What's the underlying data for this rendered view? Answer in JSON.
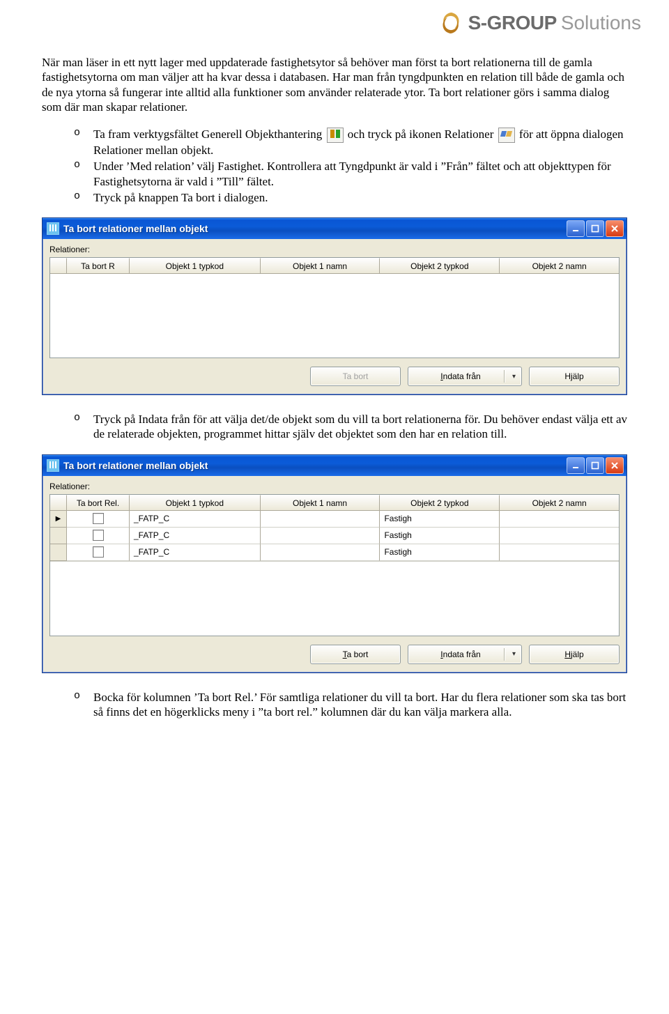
{
  "brand": {
    "name1": "S-GROUP",
    "name2": "Solutions"
  },
  "para1": "När man läser in ett nytt lager med uppdaterade fastighetsytor så behöver man först ta bort relationerna till de gamla fastighetsytorna om man väljer att ha kvar dessa i databasen. Har man från tyngdpunkten en relation till både de gamla och de nya ytorna så fungerar inte alltid alla funktioner som använder relaterade ytor.",
  "para2": "Ta bort relationer görs i samma dialog som där man skapar relationer.",
  "bullets1": {
    "b1a": "Ta fram verktygsfältet Generell Objekthantering ",
    "b1b": " och tryck på ikonen Relationer ",
    "b1c": " för att öppna dialogen Relationer mellan objekt.",
    "b2": "Under ’Med relation’ välj Fastighet. Kontrollera att Tyngdpunkt är vald i ”Från” fältet och att objekttypen för Fastighetsytorna är vald i ”Till” fältet.",
    "b3": "Tryck på knappen Ta bort i dialogen."
  },
  "bullets2": {
    "b1": "Tryck på Indata från för att välja det/de objekt som du vill ta bort relationerna för. Du behöver endast välja ett av de relaterade objekten, programmet hittar själv det objektet som den har en relation till."
  },
  "bullets3": {
    "b1": "Bocka för kolumnen ’Ta bort Rel.’ För samtliga relationer du vill ta bort. Har du flera relationer som ska tas bort så finns det en högerklicks meny i ”ta bort rel.” kolumnen där du kan välja markera alla."
  },
  "dialog": {
    "title": "Ta bort relationer mellan objekt",
    "label": "Relationer:",
    "columns": {
      "chk_short": "Ta bort R",
      "chk_full": "Ta bort Rel.",
      "o1t": "Objekt 1 typkod",
      "o1n": "Objekt 1 namn",
      "o2t": "Objekt 2 typkod",
      "o2n": "Objekt 2 namn"
    },
    "buttons": {
      "tabort_plain": "Ta bort",
      "tabort_accel_pre": "",
      "tabort_accel_key": "T",
      "tabort_accel_post": "a bort",
      "indata_pre": "",
      "indata_key": "I",
      "indata_post": "ndata från",
      "hjalp_plain": "Hjälp",
      "hjalp_pre": "",
      "hjalp_key": "H",
      "hjalp_post": "jälp"
    },
    "rows": [
      {
        "o1t": "_FATP_C",
        "o1n": "",
        "o2t": "Fastigh",
        "o2n": ""
      },
      {
        "o1t": "_FATP_C",
        "o1n": "",
        "o2t": "Fastigh",
        "o2n": ""
      },
      {
        "o1t": "_FATP_C",
        "o1n": "",
        "o2t": "Fastigh",
        "o2n": ""
      }
    ]
  }
}
